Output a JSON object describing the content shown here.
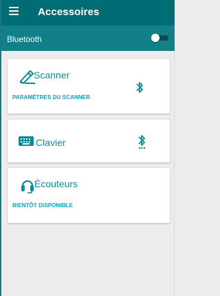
{
  "app": {
    "title": "Accessoires"
  },
  "bluetooth": {
    "label": "Bluetooth",
    "enabled": false
  },
  "cards": [
    {
      "title": "Scanner",
      "subtitle": "PARAMÈTRES DU SCANNER",
      "icon": "pen-icon",
      "status_icon": "bluetooth-icon"
    },
    {
      "title": "Clavier",
      "icon": "keyboard-icon",
      "status_icon": "bluetooth-searching-icon"
    },
    {
      "title": "Écouteurs",
      "subtitle": "BIENTÔT DISPONIBLE",
      "icon": "headset-icon"
    }
  ],
  "colors": {
    "appbar": "#006d74",
    "bluetooth_bar": "#128088",
    "accent": "#0d8b99",
    "link": "#0aa0c0",
    "background": "#ececec"
  }
}
